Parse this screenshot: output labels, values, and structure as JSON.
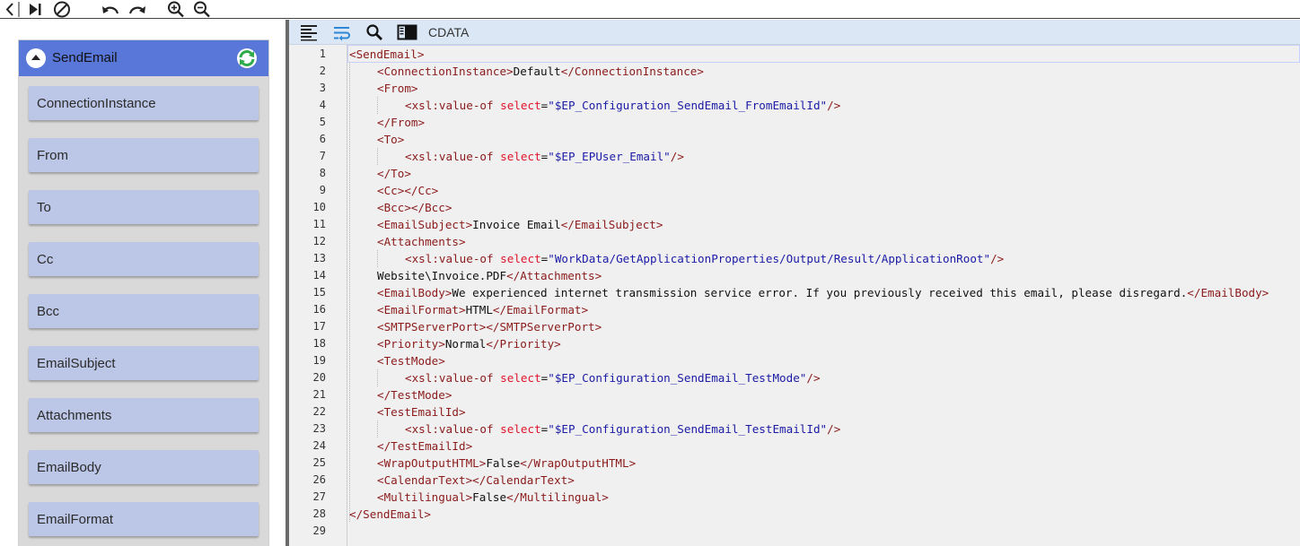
{
  "toolbar": {
    "icons": [
      "back-icon",
      "step-forward-icon",
      "stop-icon",
      "undo-icon",
      "redo-icon",
      "zoom-in-icon",
      "zoom-out-icon"
    ]
  },
  "tree": {
    "title": "SendEmail",
    "header_color": "#5877d9",
    "item_color": "#bcc6e6",
    "items": [
      "ConnectionInstance",
      "From",
      "To",
      "Cc",
      "Bcc",
      "EmailSubject",
      "Attachments",
      "EmailBody",
      "EmailFormat"
    ]
  },
  "editor": {
    "toolbar": {
      "icons": [
        "align-left-icon",
        "word-wrap-icon",
        "search-icon",
        "toggle-panel-icon"
      ],
      "cdata_label": "CDATA"
    },
    "lines": [
      {
        "indent": 0,
        "tokens": [
          {
            "t": "tag",
            "v": "<SendEmail>"
          }
        ]
      },
      {
        "indent": 1,
        "tokens": [
          {
            "t": "tag",
            "v": "<ConnectionInstance>"
          },
          {
            "t": "txt",
            "v": "Default"
          },
          {
            "t": "tag",
            "v": "</ConnectionInstance>"
          }
        ]
      },
      {
        "indent": 1,
        "tokens": [
          {
            "t": "tag",
            "v": "<From>"
          }
        ]
      },
      {
        "indent": 2,
        "tokens": [
          {
            "t": "tag",
            "v": "<xsl:value-of "
          },
          {
            "t": "attr",
            "v": "select"
          },
          {
            "t": "txt",
            "v": "="
          },
          {
            "t": "str",
            "v": "\"$EP_Configuration_SendEmail_FromEmailId\""
          },
          {
            "t": "tag",
            "v": "/>"
          }
        ]
      },
      {
        "indent": 1,
        "tokens": [
          {
            "t": "tag",
            "v": "</From>"
          }
        ]
      },
      {
        "indent": 1,
        "tokens": [
          {
            "t": "tag",
            "v": "<To>"
          }
        ]
      },
      {
        "indent": 2,
        "tokens": [
          {
            "t": "tag",
            "v": "<xsl:value-of "
          },
          {
            "t": "attr",
            "v": "select"
          },
          {
            "t": "txt",
            "v": "="
          },
          {
            "t": "str",
            "v": "\"$EP_EPUser_Email\""
          },
          {
            "t": "tag",
            "v": "/>"
          }
        ]
      },
      {
        "indent": 1,
        "tokens": [
          {
            "t": "tag",
            "v": "</To>"
          }
        ]
      },
      {
        "indent": 1,
        "tokens": [
          {
            "t": "tag",
            "v": "<Cc></Cc>"
          }
        ]
      },
      {
        "indent": 1,
        "tokens": [
          {
            "t": "tag",
            "v": "<Bcc></Bcc>"
          }
        ]
      },
      {
        "indent": 1,
        "tokens": [
          {
            "t": "tag",
            "v": "<EmailSubject>"
          },
          {
            "t": "txt",
            "v": "Invoice Email"
          },
          {
            "t": "tag",
            "v": "</EmailSubject>"
          }
        ]
      },
      {
        "indent": 1,
        "tokens": [
          {
            "t": "tag",
            "v": "<Attachments>"
          }
        ]
      },
      {
        "indent": 2,
        "tokens": [
          {
            "t": "tag",
            "v": "<xsl:value-of "
          },
          {
            "t": "attr",
            "v": "select"
          },
          {
            "t": "txt",
            "v": "="
          },
          {
            "t": "str",
            "v": "\"WorkData/GetApplicationProperties/Output/Result/ApplicationRoot\""
          },
          {
            "t": "tag",
            "v": "/>"
          }
        ]
      },
      {
        "indent": 1,
        "tokens": [
          {
            "t": "txt",
            "v": "Website\\Invoice.PDF"
          },
          {
            "t": "tag",
            "v": "</Attachments>"
          }
        ]
      },
      {
        "indent": 1,
        "tokens": [
          {
            "t": "tag",
            "v": "<EmailBody>"
          },
          {
            "t": "txt",
            "v": "We experienced internet transmission service error. If you previously received this email, please disregard."
          },
          {
            "t": "tag",
            "v": "</EmailBody>"
          }
        ]
      },
      {
        "indent": 1,
        "tokens": [
          {
            "t": "tag",
            "v": "<EmailFormat>"
          },
          {
            "t": "txt",
            "v": "HTML"
          },
          {
            "t": "tag",
            "v": "</EmailFormat>"
          }
        ]
      },
      {
        "indent": 1,
        "tokens": [
          {
            "t": "tag",
            "v": "<SMTPServerPort></SMTPServerPort>"
          }
        ]
      },
      {
        "indent": 1,
        "tokens": [
          {
            "t": "tag",
            "v": "<Priority>"
          },
          {
            "t": "txt",
            "v": "Normal"
          },
          {
            "t": "tag",
            "v": "</Priority>"
          }
        ]
      },
      {
        "indent": 1,
        "tokens": [
          {
            "t": "tag",
            "v": "<TestMode>"
          }
        ]
      },
      {
        "indent": 2,
        "tokens": [
          {
            "t": "tag",
            "v": "<xsl:value-of "
          },
          {
            "t": "attr",
            "v": "select"
          },
          {
            "t": "txt",
            "v": "="
          },
          {
            "t": "str",
            "v": "\"$EP_Configuration_SendEmail_TestMode\""
          },
          {
            "t": "tag",
            "v": "/>"
          }
        ]
      },
      {
        "indent": 1,
        "tokens": [
          {
            "t": "tag",
            "v": "</TestMode>"
          }
        ]
      },
      {
        "indent": 1,
        "tokens": [
          {
            "t": "tag",
            "v": "<TestEmailId>"
          }
        ]
      },
      {
        "indent": 2,
        "tokens": [
          {
            "t": "tag",
            "v": "<xsl:value-of "
          },
          {
            "t": "attr",
            "v": "select"
          },
          {
            "t": "txt",
            "v": "="
          },
          {
            "t": "str",
            "v": "\"$EP_Configuration_SendEmail_TestEmailId\""
          },
          {
            "t": "tag",
            "v": "/>"
          }
        ]
      },
      {
        "indent": 1,
        "tokens": [
          {
            "t": "tag",
            "v": "</TestEmailId>"
          }
        ]
      },
      {
        "indent": 1,
        "tokens": [
          {
            "t": "tag",
            "v": "<WrapOutputHTML>"
          },
          {
            "t": "txt",
            "v": "False"
          },
          {
            "t": "tag",
            "v": "</WrapOutputHTML>"
          }
        ]
      },
      {
        "indent": 1,
        "tokens": [
          {
            "t": "tag",
            "v": "<CalendarText></CalendarText>"
          }
        ]
      },
      {
        "indent": 1,
        "tokens": [
          {
            "t": "tag",
            "v": "<Multilingual>"
          },
          {
            "t": "txt",
            "v": "False"
          },
          {
            "t": "tag",
            "v": "</Multilingual>"
          }
        ]
      },
      {
        "indent": 0,
        "tokens": [
          {
            "t": "tag",
            "v": "</SendEmail>"
          }
        ]
      },
      {
        "indent": 0,
        "tokens": []
      }
    ],
    "colors": {
      "tag": "#8b1a1a",
      "attr": "#e0142a",
      "string": "#1a1aa6",
      "text": "#111111"
    }
  }
}
